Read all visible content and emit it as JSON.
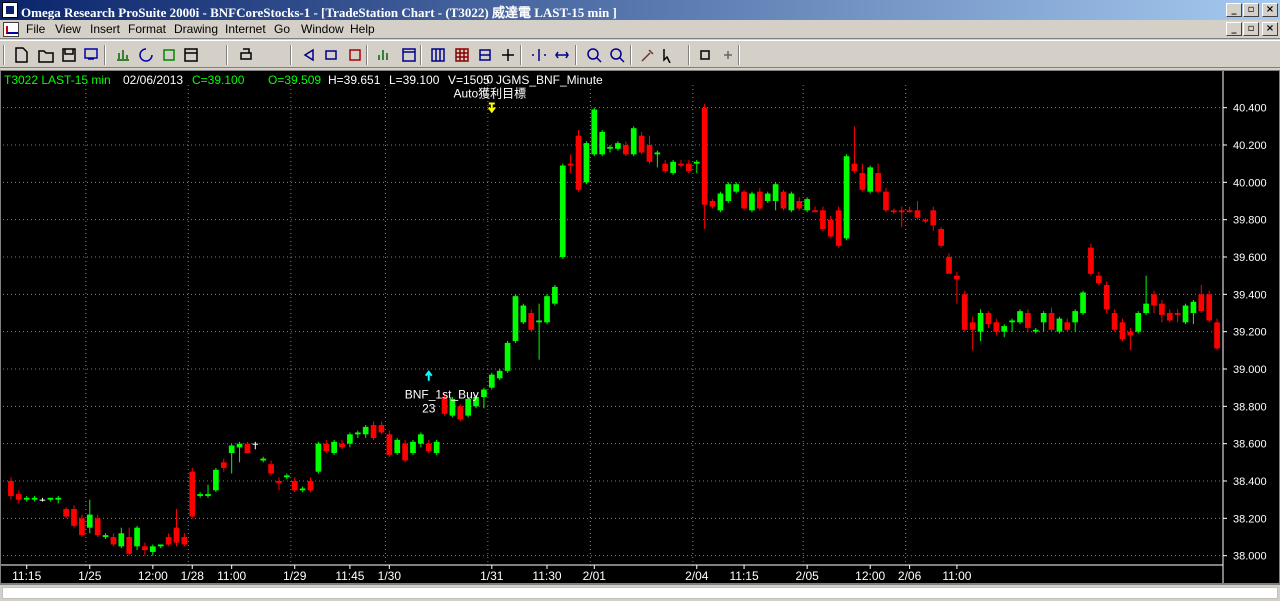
{
  "window": {
    "title": "Omega Research ProSuite 2000i - BNFCoreStocks-1 - [TradeStation Chart - (T3022) 威達電 LAST-15 min ]"
  },
  "menu": [
    "File",
    "View",
    "Insert",
    "Format",
    "Drawing",
    "Internet",
    "Go",
    "Window",
    "Help"
  ],
  "toolbar_icons": [
    "new-file-icon",
    "open-folder-icon",
    "save-icon",
    "print-preview-icon",
    "chart-icon",
    "refresh-icon",
    "green-icon",
    "insert-icon",
    "print-icon",
    "back-icon",
    "forward-icon",
    "format-icon",
    "bar-chart-icon",
    "window-icon",
    "grid-icon",
    "table-icon",
    "ticker-icon",
    "strategy-icon",
    "zoom-scroll-icon",
    "expand-icon",
    "zoom-in-icon",
    "zoom-out-icon",
    "tools-icon",
    "pointer-icon",
    "g-icon",
    "hand-icon"
  ],
  "status": {
    "symbol": "T3022 LAST-15 min",
    "date": "02/06/2013",
    "close": "C=39.100",
    "open": "O=39.509",
    "high": "H=39.651",
    "low": "L=39.100",
    "volume": "V=1505",
    "indicator": "JGMS_BNF_Minute"
  },
  "colors": {
    "up": "#00ff00",
    "down": "#ff0000",
    "flat": "#ffffff",
    "background": "#000000",
    "grid": "#7f7f7f"
  },
  "chart_data": {
    "type": "candlestick",
    "ylim": [
      37.95,
      40.5
    ],
    "yticks": [
      "40.400",
      "40.200",
      "40.000",
      "39.800",
      "39.600",
      "39.400",
      "39.200",
      "39.000",
      "38.800",
      "38.600",
      "38.400",
      "38.200",
      "38.000"
    ],
    "xticks": [
      {
        "i": 2,
        "label": "11:15"
      },
      {
        "i": 10,
        "label": "1/25"
      },
      {
        "i": 18,
        "label": "12:00"
      },
      {
        "i": 23,
        "label": "1/28"
      },
      {
        "i": 28,
        "label": "11:00"
      },
      {
        "i": 36,
        "label": "1/29"
      },
      {
        "i": 43,
        "label": "11:45"
      },
      {
        "i": 48,
        "label": "1/30"
      },
      {
        "i": 61,
        "label": "1/31"
      },
      {
        "i": 68,
        "label": "11:30"
      },
      {
        "i": 74,
        "label": "2/01"
      },
      {
        "i": 87,
        "label": "2/04"
      },
      {
        "i": 93,
        "label": "11:15"
      },
      {
        "i": 101,
        "label": "2/05"
      },
      {
        "i": 109,
        "label": "12:00"
      },
      {
        "i": 114,
        "label": "2/06"
      },
      {
        "i": 120,
        "label": "11:00"
      }
    ],
    "vlines": [
      10,
      23,
      36,
      48,
      61,
      74,
      87,
      101,
      114
    ],
    "candles": [
      [
        38.4,
        38.42,
        38.3,
        38.32
      ],
      [
        38.33,
        38.35,
        38.28,
        38.3
      ],
      [
        38.3,
        38.32,
        38.29,
        38.31
      ],
      [
        38.3,
        38.32,
        38.29,
        38.31
      ],
      [
        38.3,
        38.31,
        38.29,
        38.3
      ],
      [
        38.3,
        38.31,
        38.29,
        38.31
      ],
      [
        38.3,
        38.32,
        38.28,
        38.31
      ],
      [
        38.25,
        38.26,
        38.2,
        38.21
      ],
      [
        38.25,
        38.27,
        38.15,
        38.16
      ],
      [
        38.2,
        38.22,
        38.1,
        38.11
      ],
      [
        38.15,
        38.3,
        38.12,
        38.22
      ],
      [
        38.2,
        38.22,
        38.1,
        38.11
      ],
      [
        38.1,
        38.12,
        38.09,
        38.11
      ],
      [
        38.1,
        38.12,
        38.05,
        38.06
      ],
      [
        38.05,
        38.15,
        38.04,
        38.12
      ],
      [
        38.1,
        38.15,
        38.0,
        38.01
      ],
      [
        38.05,
        38.16,
        38.03,
        38.15
      ],
      [
        38.05,
        38.07,
        38.0,
        38.03
      ],
      [
        38.02,
        38.06,
        38.0,
        38.05
      ],
      [
        38.05,
        38.06,
        38.04,
        38.06
      ],
      [
        38.1,
        38.12,
        38.05,
        38.06
      ],
      [
        38.15,
        38.25,
        38.05,
        38.07
      ],
      [
        38.1,
        38.12,
        38.05,
        38.06
      ],
      [
        38.45,
        38.47,
        38.2,
        38.21
      ],
      [
        38.32,
        38.34,
        38.31,
        38.33
      ],
      [
        38.32,
        38.38,
        38.31,
        38.33
      ],
      [
        38.35,
        38.47,
        38.34,
        38.46
      ],
      [
        38.5,
        38.52,
        38.45,
        38.47
      ],
      [
        38.55,
        38.6,
        38.44,
        38.59
      ],
      [
        38.58,
        38.61,
        38.5,
        38.6
      ],
      [
        38.6,
        38.61,
        38.57,
        38.55
      ],
      [
        38.6,
        38.61,
        38.57,
        38.6
      ],
      [
        38.51,
        38.53,
        38.5,
        38.52
      ],
      [
        38.49,
        38.51,
        38.43,
        38.44
      ],
      [
        38.4,
        38.42,
        38.35,
        38.39
      ],
      [
        38.42,
        38.44,
        38.41,
        38.43
      ],
      [
        38.4,
        38.42,
        38.34,
        38.35
      ],
      [
        38.35,
        38.37,
        38.34,
        38.36
      ],
      [
        38.4,
        38.42,
        38.34,
        38.35
      ],
      [
        38.45,
        38.61,
        38.44,
        38.6
      ],
      [
        38.6,
        38.62,
        38.55,
        38.56
      ],
      [
        38.55,
        38.62,
        38.54,
        38.61
      ],
      [
        38.6,
        38.62,
        38.57,
        38.58
      ],
      [
        38.6,
        38.66,
        38.58,
        38.65
      ],
      [
        38.65,
        38.67,
        38.63,
        38.66
      ],
      [
        38.65,
        38.7,
        38.63,
        38.69
      ],
      [
        38.7,
        38.72,
        38.62,
        38.63
      ],
      [
        38.7,
        38.72,
        38.65,
        38.66
      ],
      [
        38.65,
        38.67,
        38.53,
        38.54
      ],
      [
        38.55,
        38.63,
        38.54,
        38.62
      ],
      [
        38.6,
        38.62,
        38.5,
        38.51
      ],
      [
        38.55,
        38.62,
        38.54,
        38.61
      ],
      [
        38.6,
        38.66,
        38.58,
        38.65
      ],
      [
        38.6,
        38.62,
        38.55,
        38.56
      ],
      [
        38.55,
        38.62,
        38.54,
        38.61
      ],
      [
        38.85,
        38.87,
        38.75,
        38.76
      ],
      [
        38.75,
        38.85,
        38.74,
        38.84
      ],
      [
        38.8,
        38.81,
        38.72,
        38.73
      ],
      [
        38.75,
        38.85,
        38.74,
        38.84
      ],
      [
        38.8,
        38.86,
        38.79,
        38.85
      ],
      [
        38.85,
        38.9,
        38.79,
        38.89
      ],
      [
        38.9,
        38.98,
        38.89,
        38.97
      ],
      [
        38.95,
        39.0,
        38.94,
        38.99
      ],
      [
        38.99,
        39.15,
        38.98,
        39.14
      ],
      [
        39.15,
        39.4,
        39.14,
        39.39
      ],
      [
        39.25,
        39.35,
        39.24,
        39.34
      ],
      [
        39.3,
        39.32,
        39.2,
        39.21
      ],
      [
        39.25,
        39.35,
        39.05,
        39.26
      ],
      [
        39.25,
        39.4,
        39.24,
        39.39
      ],
      [
        39.35,
        39.45,
        39.34,
        39.44
      ],
      [
        39.6,
        40.1,
        39.59,
        40.09
      ],
      [
        40.1,
        40.15,
        40.05,
        40.09
      ],
      [
        40.25,
        40.28,
        39.95,
        39.96
      ],
      [
        40.0,
        40.22,
        39.99,
        40.21
      ],
      [
        40.15,
        40.4,
        40.14,
        40.39
      ],
      [
        40.15,
        40.28,
        40.14,
        40.27
      ],
      [
        40.18,
        40.2,
        40.16,
        40.19
      ],
      [
        40.18,
        40.22,
        40.17,
        40.21
      ],
      [
        40.2,
        40.22,
        40.14,
        40.15
      ],
      [
        40.15,
        40.3,
        40.14,
        40.29
      ],
      [
        40.25,
        40.27,
        40.15,
        40.16
      ],
      [
        40.2,
        40.25,
        40.1,
        40.11
      ],
      [
        40.15,
        40.17,
        40.08,
        40.16
      ],
      [
        40.1,
        40.12,
        40.05,
        40.06
      ],
      [
        40.05,
        40.12,
        40.04,
        40.11
      ],
      [
        40.1,
        40.12,
        40.08,
        40.09
      ],
      [
        40.1,
        40.12,
        40.05,
        40.06
      ],
      [
        40.1,
        40.12,
        40.05,
        40.11
      ],
      [
        40.4,
        40.42,
        39.75,
        39.88
      ],
      [
        39.9,
        39.91,
        39.86,
        39.87
      ],
      [
        39.85,
        39.95,
        39.84,
        39.94
      ],
      [
        39.9,
        40.0,
        39.89,
        39.99
      ],
      [
        39.95,
        40.0,
        39.94,
        39.99
      ],
      [
        39.95,
        39.96,
        39.85,
        39.86
      ],
      [
        39.85,
        39.95,
        39.84,
        39.94
      ],
      [
        39.95,
        39.97,
        39.85,
        39.86
      ],
      [
        39.9,
        39.95,
        39.89,
        39.94
      ],
      [
        39.9,
        40.0,
        39.85,
        39.99
      ],
      [
        39.95,
        39.96,
        39.85,
        39.86
      ],
      [
        39.85,
        39.95,
        39.84,
        39.94
      ],
      [
        39.9,
        39.92,
        39.85,
        39.86
      ],
      [
        39.85,
        39.92,
        39.84,
        39.91
      ],
      [
        39.85,
        39.87,
        39.84,
        39.84
      ],
      [
        39.85,
        39.87,
        39.74,
        39.75
      ],
      [
        39.8,
        39.82,
        39.7,
        39.71
      ],
      [
        39.85,
        39.87,
        39.65,
        39.66
      ],
      [
        39.7,
        40.15,
        39.69,
        40.14
      ],
      [
        40.1,
        40.3,
        40.05,
        40.06
      ],
      [
        40.05,
        40.1,
        39.95,
        39.96
      ],
      [
        39.95,
        40.09,
        39.94,
        40.08
      ],
      [
        40.05,
        40.1,
        39.94,
        39.95
      ],
      [
        39.95,
        39.97,
        39.84,
        39.85
      ],
      [
        39.85,
        39.86,
        39.83,
        39.84
      ],
      [
        39.85,
        39.87,
        39.76,
        39.84
      ],
      [
        39.85,
        39.87,
        39.84,
        39.84
      ],
      [
        39.85,
        39.9,
        39.8,
        39.81
      ],
      [
        39.8,
        39.81,
        39.78,
        39.79
      ]
    ],
    "annotations": [
      {
        "i": 61,
        "price": 40.39,
        "top_label": "0",
        "label": "Auto獲利目標",
        "kind": "exit"
      },
      {
        "i": 53,
        "price": 38.98,
        "label": "BNF_1st_Buy",
        "bottom_label": "23",
        "kind": "entry"
      }
    ],
    "extra_candles_late": [
      [
        39.85,
        39.87,
        39.74,
        39.77
      ],
      [
        39.75,
        39.76,
        39.65,
        39.66
      ],
      [
        39.6,
        39.62,
        39.55,
        39.51
      ],
      [
        39.5,
        39.52,
        39.35,
        39.48
      ],
      [
        39.4,
        39.42,
        39.2,
        39.21
      ],
      [
        39.25,
        39.28,
        39.1,
        39.21
      ],
      [
        39.2,
        39.32,
        39.15,
        39.3
      ],
      [
        39.3,
        39.31,
        39.22,
        39.24
      ],
      [
        39.25,
        39.27,
        39.18,
        39.2
      ],
      [
        39.2,
        39.24,
        39.17,
        39.23
      ],
      [
        39.25,
        39.27,
        39.2,
        39.26
      ],
      [
        39.25,
        39.32,
        39.24,
        39.31
      ],
      [
        39.3,
        39.32,
        39.2,
        39.22
      ],
      [
        39.2,
        39.22,
        39.19,
        39.21
      ],
      [
        39.25,
        39.31,
        39.2,
        39.3
      ],
      [
        39.3,
        39.33,
        39.2,
        39.21
      ],
      [
        39.2,
        39.28,
        39.19,
        39.27
      ],
      [
        39.25,
        39.27,
        39.2,
        39.21
      ],
      [
        39.25,
        39.32,
        39.2,
        39.31
      ],
      [
        39.3,
        39.42,
        39.29,
        39.41
      ],
      [
        39.65,
        39.67,
        39.5,
        39.51
      ],
      [
        39.5,
        39.52,
        39.45,
        39.46
      ],
      [
        39.45,
        39.47,
        39.3,
        39.32
      ],
      [
        39.3,
        39.32,
        39.2,
        39.21
      ],
      [
        39.25,
        39.27,
        39.15,
        39.16
      ],
      [
        39.2,
        39.22,
        39.1,
        39.18
      ],
      [
        39.2,
        39.31,
        39.19,
        39.3
      ],
      [
        39.3,
        39.5,
        39.29,
        39.35
      ],
      [
        39.4,
        39.42,
        39.3,
        39.34
      ],
      [
        39.35,
        39.37,
        39.25,
        39.29
      ],
      [
        39.3,
        39.32,
        39.25,
        39.26
      ],
      [
        39.3,
        39.32,
        39.25,
        39.29
      ],
      [
        39.25,
        39.35,
        39.24,
        39.34
      ],
      [
        39.3,
        39.37,
        39.24,
        39.36
      ],
      [
        39.4,
        39.45,
        39.3,
        39.31
      ],
      [
        39.4,
        39.42,
        39.25,
        39.26
      ],
      [
        39.25,
        39.27,
        39.1,
        39.11
      ]
    ]
  }
}
